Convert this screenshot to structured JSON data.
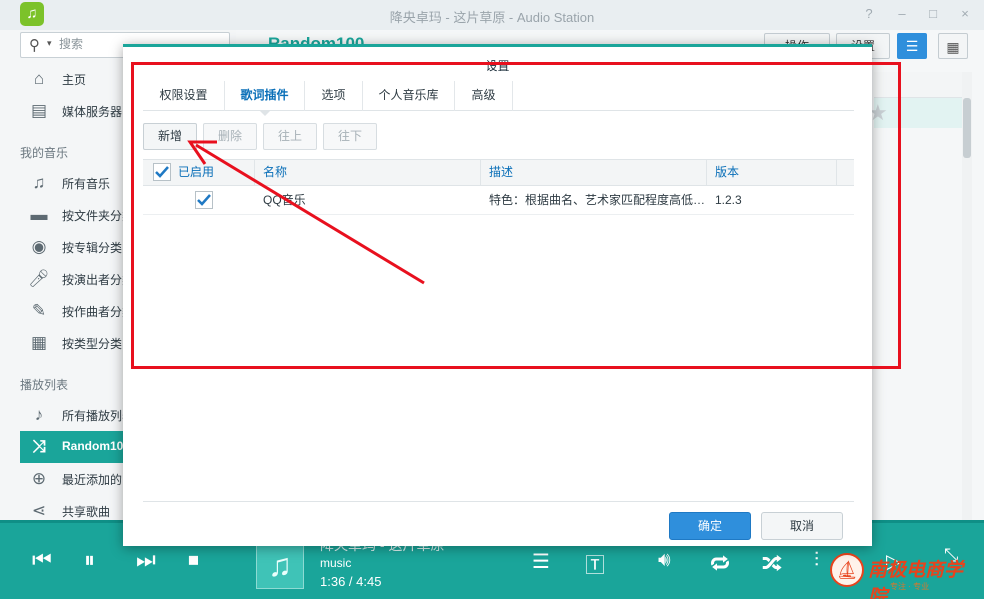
{
  "window": {
    "title": "降央卓玛 - 这片草原 - Audio Station",
    "controls": [
      "?",
      "–",
      "□",
      "×"
    ]
  },
  "sidebar": {
    "search_placeholder": "搜索",
    "items_top": [
      {
        "label": "主页",
        "icon": "home-icon"
      },
      {
        "label": "媒体服务器",
        "icon": "media-server-icon"
      }
    ],
    "section_my_music": "我的音乐",
    "items_music": [
      {
        "label": "所有音乐",
        "icon": "music-note-icon"
      },
      {
        "label": "按文件夹分类",
        "icon": "folder-icon"
      },
      {
        "label": "按专辑分类",
        "icon": "disc-icon"
      },
      {
        "label": "按演出者分类",
        "icon": "microphone-icon"
      },
      {
        "label": "按作曲者分类",
        "icon": "pen-icon"
      },
      {
        "label": "按类型分类",
        "icon": "grid-icon"
      }
    ],
    "section_playlists": "播放列表",
    "items_playlists": [
      {
        "label": "所有播放列表",
        "icon": "playlist-icon"
      },
      {
        "label": "Random100",
        "icon": "shuffle-icon"
      },
      {
        "label": "最近添加的",
        "icon": "plus-circle-icon"
      },
      {
        "label": "共享歌曲",
        "icon": "share-icon"
      }
    ]
  },
  "main": {
    "title": "Random100",
    "actions_label": "操作",
    "settings_label": "设置"
  },
  "dialog": {
    "title": "设置",
    "tabs": [
      "权限设置",
      "歌词插件",
      "选项",
      "个人音乐库",
      "高级"
    ],
    "active_tab": 1,
    "buttons": {
      "add": "新增",
      "delete": "删除",
      "up": "往上",
      "down": "往下"
    },
    "columns": {
      "enabled": "已启用",
      "name": "名称",
      "description": "描述",
      "version": "版本"
    },
    "rows": [
      {
        "enabled": true,
        "name": "QQ音乐",
        "description": "特色：根据曲名、艺术家匹配程度高低…",
        "version": "1.2.3"
      }
    ],
    "ok": "确定",
    "cancel": "取消"
  },
  "player": {
    "track_title": "降央卓玛 - 这片草原",
    "folder": "music",
    "time": "1:36 / 4:45"
  },
  "watermark": {
    "text": "南极电商学院",
    "sub": "专注 · 专业"
  },
  "colors": {
    "accent": "#1aa59a",
    "tab_active": "#0a6fb8",
    "primary_button": "#2f8fdc",
    "annotation": "#e8101e"
  }
}
